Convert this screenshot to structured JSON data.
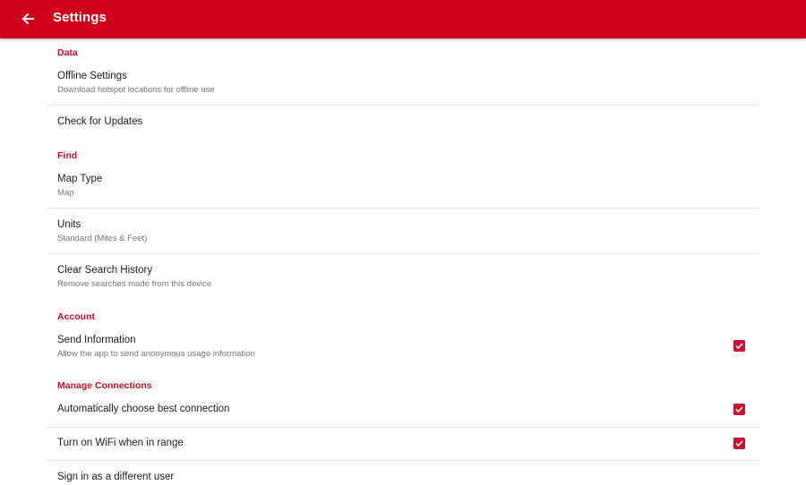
{
  "appbar": {
    "title": "Settings",
    "back_icon": "arrow-left-icon",
    "color": "#d0021b"
  },
  "accent_color": "#c8102e",
  "sections": {
    "data": {
      "header": "Data",
      "offline": {
        "title": "Offline Settings",
        "subtitle": "Download hotspot locations for offline use"
      },
      "updates": {
        "title": "Check for Updates"
      }
    },
    "find": {
      "header": "Find",
      "map_type": {
        "title": "Map Type",
        "subtitle": "Map"
      },
      "units": {
        "title": "Units",
        "subtitle": "Standard (Miles & Feet)"
      },
      "clear_history": {
        "title": "Clear Search History",
        "subtitle": "Remove searches made from this device"
      }
    },
    "account": {
      "header": "Account",
      "send_info": {
        "title": "Send Information",
        "subtitle": "Allow the app to send anonymous usage information",
        "checked": true
      }
    },
    "connections": {
      "header": "Manage Connections",
      "auto_best": {
        "title": "Automatically choose best connection",
        "checked": true
      },
      "wifi_range": {
        "title": "Turn on WiFi when in range",
        "checked": true
      },
      "sign_in": {
        "title": "Sign in as a different user"
      }
    }
  }
}
